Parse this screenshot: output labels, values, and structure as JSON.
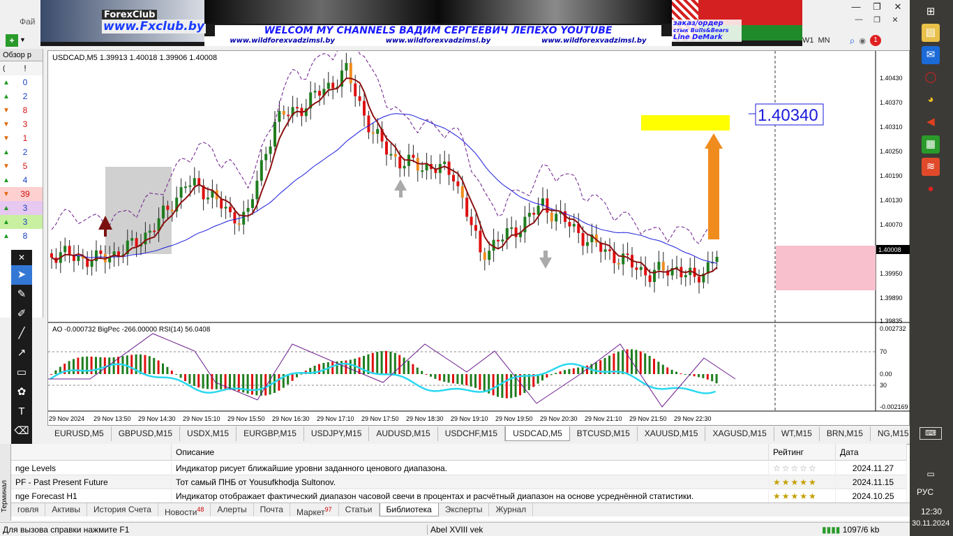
{
  "menu": {
    "file_label": "Фай"
  },
  "banner": {
    "logo_text": "ForexClub",
    "site": "www.Fxclub.by",
    "welcome": "WELCOM MY CHANNELS ВАДИМ СЕРГЕЕВИЧ ЛЕПЕХО YOUTUBE",
    "links": [
      "www.wildforexvadzimsl.by",
      "www.wildforexvadzimsl.by",
      "www.wildforexvadzimsl.by"
    ],
    "order_lines": [
      "заказ/ордер",
      "стык Bulls&Bears",
      "Line DeMark"
    ]
  },
  "window_controls": {
    "minimize": "—",
    "restore": "❐",
    "close": "✕"
  },
  "toolbar": {
    "tf_w1": "W1",
    "tf_mn": "MN",
    "notif_count": "1"
  },
  "market_watch": {
    "header": "Обзор р",
    "col1": "(",
    "col2": "!",
    "rows": [
      {
        "dir": "up",
        "v": "0"
      },
      {
        "dir": "up",
        "v": "2"
      },
      {
        "dir": "dn",
        "v": "8"
      },
      {
        "dir": "dn",
        "v": "3"
      },
      {
        "dir": "dn",
        "v": "1"
      },
      {
        "dir": "up",
        "v": "2"
      },
      {
        "dir": "dn",
        "v": "5"
      },
      {
        "dir": "up",
        "v": "4"
      },
      {
        "dir": "dn",
        "v": "39"
      },
      {
        "dir": "up",
        "v": "3"
      },
      {
        "dir": "up",
        "v": "3"
      },
      {
        "dir": "up",
        "v": "8"
      }
    ]
  },
  "chart": {
    "header": "USDCAD,M5  1.39913 1.40018 1.39906 1.40008",
    "sub_header": "AO -0.000732  BigPec -266.00000  RSI(14) 56.0408",
    "price_tag": "1.40340",
    "current_price": "1.40008",
    "price_axis": [
      "1.40430",
      "1.40370",
      "1.40310",
      "1.40250",
      "1.40190",
      "1.40130",
      "1.40070",
      "1.40008",
      "1.39950",
      "1.39890",
      "1.39835"
    ],
    "sub_axis": [
      "0.002732",
      "70",
      "0.00",
      "30",
      "-0.002169"
    ],
    "time_axis": [
      "29 Nov 2024",
      "29 Nov 13:50",
      "29 Nov 14:30",
      "29 Nov 15:10",
      "29 Nov 15:50",
      "29 Nov 16:30",
      "29 Nov 17:10",
      "29 Nov 17:50",
      "29 Nov 18:30",
      "29 Nov 19:10",
      "29 Nov 19:50",
      "29 Nov 20:30",
      "29 Nov 21:10",
      "29 Nov 21:50",
      "29 Nov 22:30"
    ],
    "colors": {
      "bull": "#1e7d1e",
      "bear": "#e01010",
      "orange": "#f08c1e",
      "ma_blue": "#1a1adc",
      "ma_red": "#8b1010",
      "band": "#6a1a8a",
      "rsi": "#2ad8f0"
    }
  },
  "symbol_tabs": [
    "EURUSD,M5",
    "GBPUSD,M15",
    "USDX,M15",
    "EURGBP,M15",
    "USDJPY,M15",
    "AUDUSD,M15",
    "USDCHF,M15",
    "USDCAD,M5",
    "BTCUSD,M15",
    "XAUUSD,M15",
    "XAGUSD,M15",
    "WT,M15",
    "BRN,M15",
    "NG,M15"
  ],
  "active_symbol_tab": "USDCAD,M5",
  "library": {
    "columns": {
      "name": "",
      "description": "Описание",
      "rating": "Рейтинг",
      "date": "Дата"
    },
    "rows": [
      {
        "name": "nge Levels",
        "description": "Индикатор рисует ближайшие уровни заданного ценового диапазона.",
        "stars": "☆☆☆☆☆",
        "date": "2024.11.27"
      },
      {
        "name": "PF - Past Present Future",
        "description": "Тот самый ПНБ от Yousufkhodja Sultonov.",
        "stars": "★★★★★",
        "date": "2024.11.15"
      },
      {
        "name": "nge Forecast H1",
        "description": "Индикатор отображает фактический диапазон часовой свечи в процентах и расчётный диапазон на основе усреднённой статистики.",
        "stars": "★★★★★",
        "date": "2024.10.25"
      }
    ]
  },
  "terminal_label": "Терминал",
  "terminal_tabs": [
    {
      "label": "говля",
      "badge": ""
    },
    {
      "label": "Активы",
      "badge": ""
    },
    {
      "label": "История Счета",
      "badge": ""
    },
    {
      "label": "Новости",
      "badge": "48"
    },
    {
      "label": "Алерты",
      "badge": ""
    },
    {
      "label": "Почта",
      "badge": ""
    },
    {
      "label": "Маркет",
      "badge": "97"
    },
    {
      "label": "Статьи",
      "badge": ""
    },
    {
      "label": "Библиотека",
      "badge": ""
    },
    {
      "label": "Эксперты",
      "badge": ""
    },
    {
      "label": "Журнал",
      "badge": ""
    }
  ],
  "active_terminal_tab": "Библиотека",
  "status": {
    "help": "Для вызова справки нажмите F1",
    "profile": "Abel XVIII vek",
    "connection": "1097/6 kb"
  },
  "taskbar": {
    "language": "РУС",
    "time": "12:30",
    "date": "30.11.2024"
  }
}
